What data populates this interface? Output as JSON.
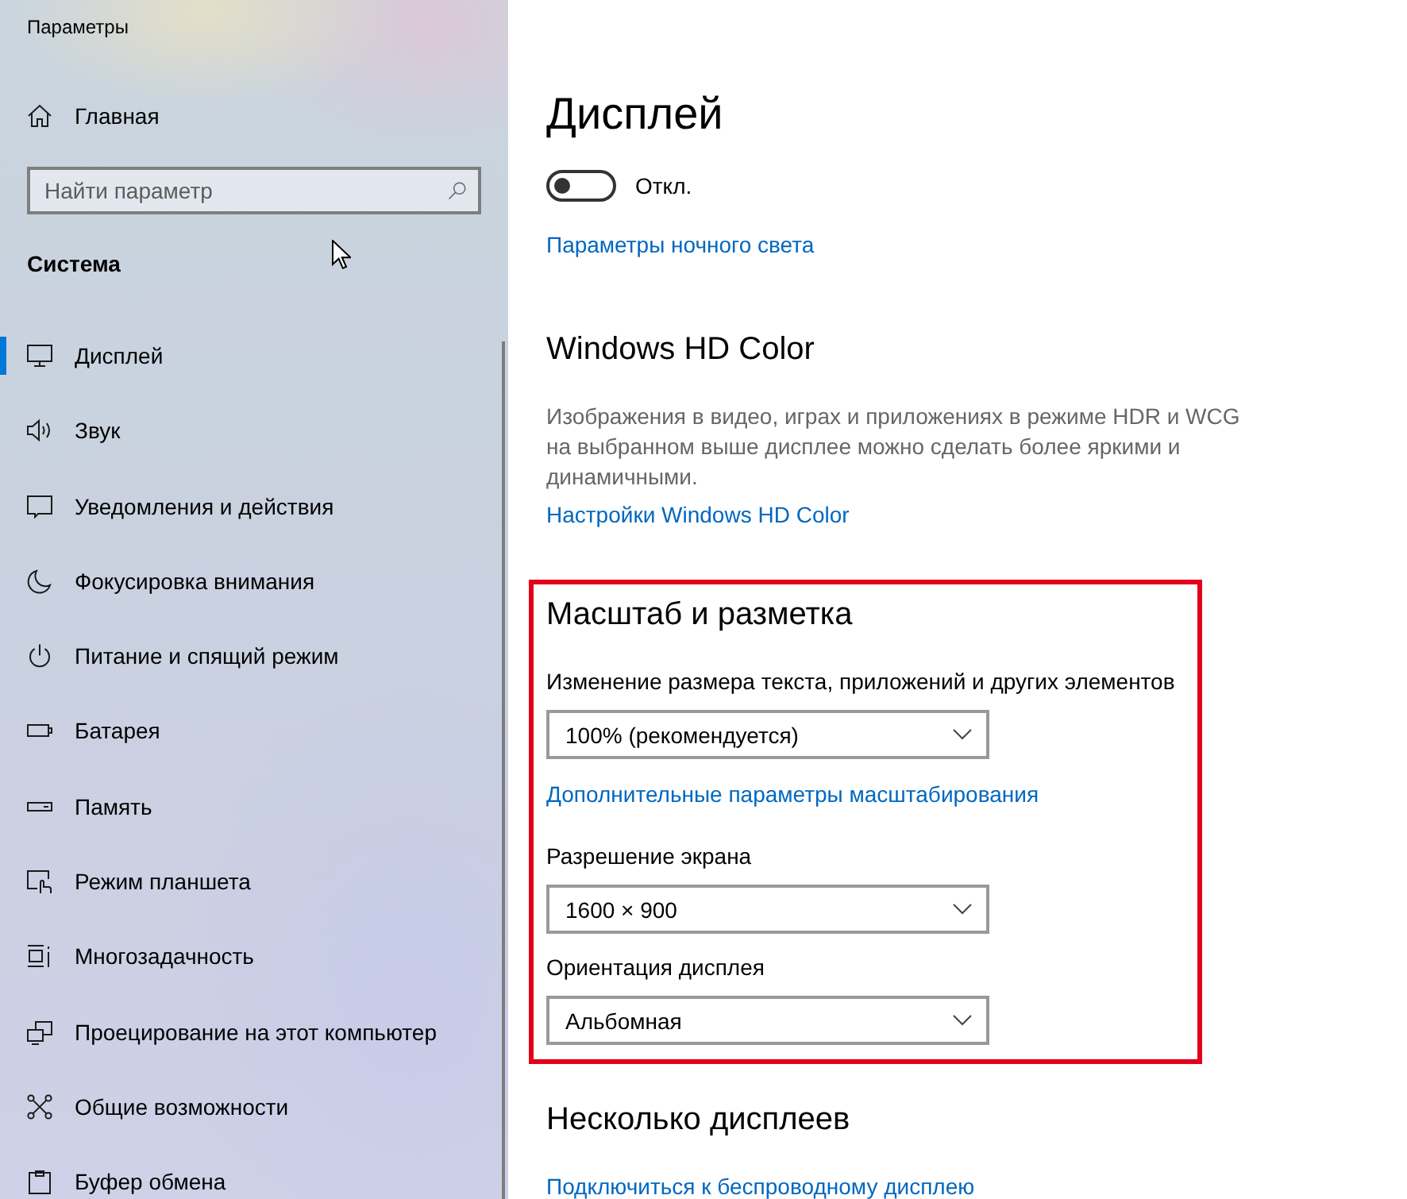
{
  "window": {
    "title": "Параметры"
  },
  "sidebar": {
    "home": "Главная",
    "search": {
      "placeholder": "Найти параметр"
    },
    "section_title": "Система",
    "items": [
      {
        "label": "Дисплей",
        "selected": true
      },
      {
        "label": "Звук",
        "selected": false
      },
      {
        "label": "Уведомления и действия",
        "selected": false
      },
      {
        "label": "Фокусировка внимания",
        "selected": false
      },
      {
        "label": "Питание и спящий режим",
        "selected": false
      },
      {
        "label": "Батарея",
        "selected": false
      },
      {
        "label": "Память",
        "selected": false
      },
      {
        "label": "Режим планшета",
        "selected": false
      },
      {
        "label": "Многозадачность",
        "selected": false
      },
      {
        "label": "Проецирование на этот компьютер",
        "selected": false
      },
      {
        "label": "Общие возможности",
        "selected": false
      },
      {
        "label": "Буфер обмена",
        "selected": false
      }
    ]
  },
  "page": {
    "title": "Дисплей",
    "night_light": {
      "on": false,
      "state_label": "Откл.",
      "link": "Параметры ночного света"
    },
    "hd_color": {
      "heading": "Windows HD Color",
      "description": "Изображения в видео, играх и приложениях в режиме HDR и WCG на выбранном выше дисплее можно сделать более яркими и динамичными.",
      "link": "Настройки Windows HD Color"
    },
    "scale_layout": {
      "heading": "Масштаб и разметка",
      "highlighted": true,
      "settings": [
        {
          "label": "Изменение размера текста, приложений и других элементов",
          "value": "100% (рекомендуется)",
          "link": "Дополнительные параметры масштабирования"
        },
        {
          "label": "Разрешение экрана",
          "value": "1600 × 900"
        },
        {
          "label": "Ориентация дисплея",
          "value": "Альбомная"
        }
      ]
    },
    "multiple_displays": {
      "heading": "Несколько дисплеев",
      "link": "Подключиться к беспроводному дисплею"
    }
  }
}
